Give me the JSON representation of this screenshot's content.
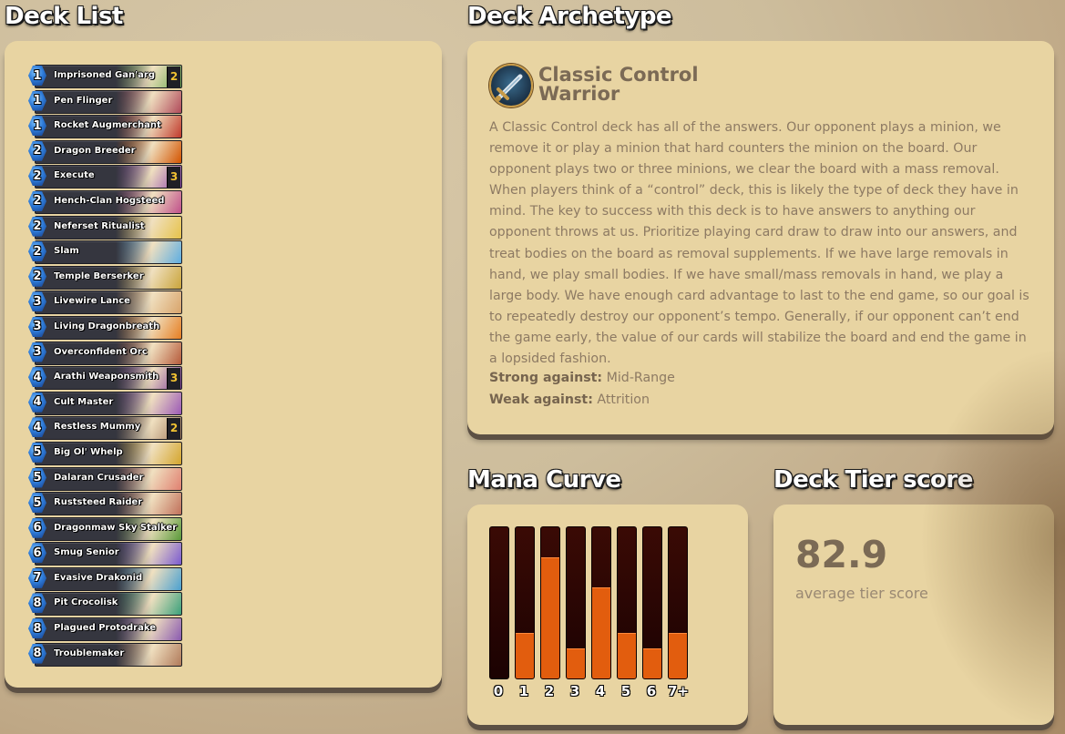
{
  "deck_list": {
    "title": "Deck List",
    "cards": [
      {
        "cost": "1",
        "name": "Imprisoned Gan'arg",
        "count": "2",
        "art": "#6aa84f"
      },
      {
        "cost": "1",
        "name": "Pen Flinger",
        "count": "",
        "art": "#b04a5a"
      },
      {
        "cost": "1",
        "name": "Rocket Augmerchant",
        "count": "",
        "art": "#c0392b"
      },
      {
        "cost": "2",
        "name": "Dragon Breeder",
        "count": "",
        "art": "#d35400"
      },
      {
        "cost": "2",
        "name": "Execute",
        "count": "3",
        "art": "#8e44ad"
      },
      {
        "cost": "2",
        "name": "Hench-Clan Hogsteed",
        "count": "",
        "art": "#c0508a"
      },
      {
        "cost": "2",
        "name": "Neferset Ritualist",
        "count": "",
        "art": "#e6c24a"
      },
      {
        "cost": "2",
        "name": "Slam",
        "count": "",
        "art": "#5dade2"
      },
      {
        "cost": "2",
        "name": "Temple Berserker",
        "count": "",
        "art": "#c9a43b"
      },
      {
        "cost": "3",
        "name": "Livewire Lance",
        "count": "",
        "art": "#d8a36a"
      },
      {
        "cost": "3",
        "name": "Living Dragonbreath",
        "count": "",
        "art": "#e67e22"
      },
      {
        "cost": "3",
        "name": "Overconfident Orc",
        "count": "",
        "art": "#b55a3a"
      },
      {
        "cost": "4",
        "name": "Arathi Weaponsmith",
        "count": "3",
        "art": "#7d3c98"
      },
      {
        "cost": "4",
        "name": "Cult Master",
        "count": "",
        "art": "#9b59b6"
      },
      {
        "cost": "4",
        "name": "Restless Mummy",
        "count": "2",
        "art": "#a0785a"
      },
      {
        "cost": "5",
        "name": "Big Ol' Whelp",
        "count": "",
        "art": "#d4a52c"
      },
      {
        "cost": "5",
        "name": "Dalaran Crusader",
        "count": "",
        "art": "#e08070"
      },
      {
        "cost": "5",
        "name": "Ruststeed Raider",
        "count": "",
        "art": "#c0705a"
      },
      {
        "cost": "6",
        "name": "Dragonmaw Sky Stalker",
        "count": "",
        "art": "#5a9a3a"
      },
      {
        "cost": "6",
        "name": "Smug Senior",
        "count": "",
        "art": "#7a5ad0"
      },
      {
        "cost": "7",
        "name": "Evasive Drakonid",
        "count": "",
        "art": "#4aa0d0"
      },
      {
        "cost": "8",
        "name": "Pit Crocolisk",
        "count": "",
        "art": "#3aa07a"
      },
      {
        "cost": "8",
        "name": "Plagued Protodrake",
        "count": "",
        "art": "#8a5ab0"
      },
      {
        "cost": "8",
        "name": "Troublemaker",
        "count": "",
        "art": "#b07a5a"
      }
    ]
  },
  "archetype": {
    "title": "Deck Archetype",
    "icon": "sword-emblem-icon",
    "name": "Classic Control Warrior",
    "description": "A Classic Control deck has all of the answers. Our opponent plays a minion, we remove it or play a minion that hard counters the minion on the board. Our opponent plays two or three minions, we clear the board with a mass removal. When players think of a “control” deck, this is likely the type of deck they have in mind. The key to success with this deck is to have answers to anything our opponent throws at us. Prioritize playing card draw to draw into our answers, and treat bodies on the board as removal supplements. If we have large removals in hand, we play small bodies. If we have small/mass removals in hand, we play a large body. We have enough card advantage to last to the end game, so our goal is to repeatedly destroy our opponent’s tempo. Generally, if our opponent can’t end the game early, the value of our cards will stabilize the board and end the game in a lopsided fashion.",
    "strong_label": "Strong against:",
    "strong_value": "Mid-Range",
    "weak_label": "Weak against:",
    "weak_value": "Attrition"
  },
  "mana_curve": {
    "title": "Mana Curve"
  },
  "chart_data": {
    "type": "bar",
    "categories": [
      "0",
      "1",
      "2",
      "3",
      "4",
      "5",
      "6",
      "7+"
    ],
    "values": [
      0,
      3,
      8,
      2,
      6,
      3,
      2,
      3
    ],
    "ylim": [
      0,
      10
    ],
    "fill_color": "#e25d0e",
    "track_color": "#2a0505"
  },
  "tier": {
    "title": "Deck Tier score",
    "value": "82.9",
    "caption": "average tier score"
  }
}
